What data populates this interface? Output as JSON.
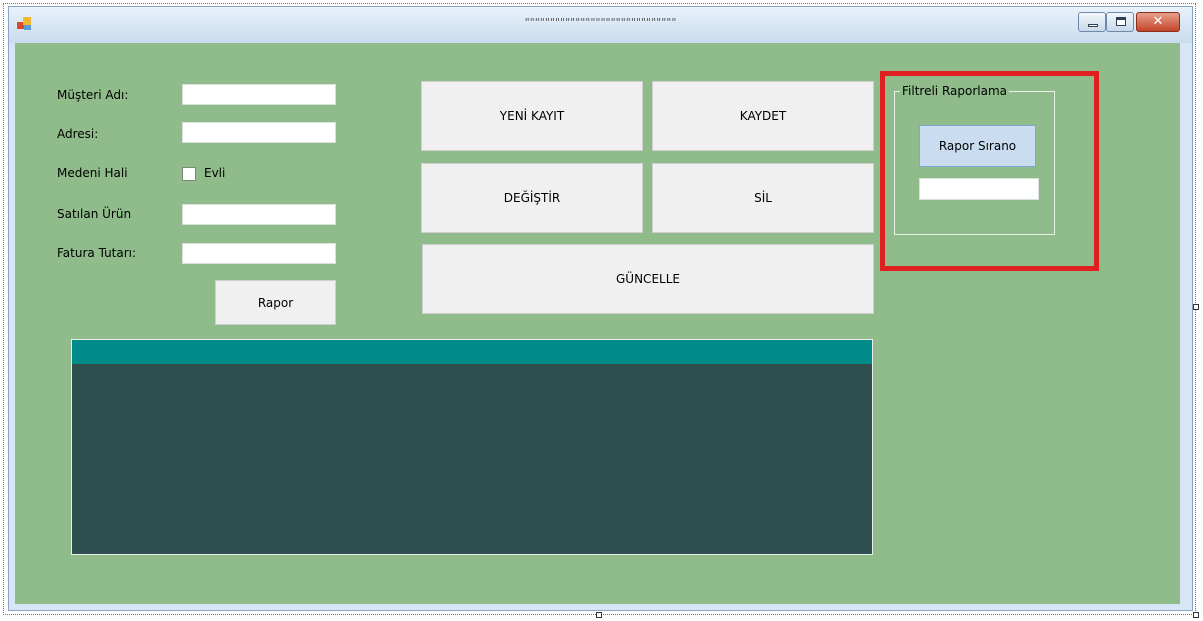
{
  "window": {
    "title": "\"\"\"\"\"\"\"\"\"\"\"\"\"\"\"\"\"\"\"\"\"\"\"\"\"\"\"\"\"\""
  },
  "window_controls": {
    "minimize_icon": "minimize-icon",
    "maximize_icon": "maximize-icon",
    "close_label": "✕"
  },
  "form": {
    "customer_name_label": "Müşteri Adı:",
    "customer_name_value": "",
    "address_label": "Adresi:",
    "address_value": "",
    "marital_status_label": "Medeni Hali",
    "married_label": "Evli",
    "married_checked": false,
    "product_sold_label": "Satılan Ürün",
    "product_sold_value": "",
    "invoice_amount_label": "Fatura Tutarı:",
    "invoice_amount_value": "",
    "report_button": "Rapor"
  },
  "actions": {
    "new_record": "YENİ KAYIT",
    "save": "KAYDET",
    "change": "DEĞİŞTİR",
    "delete": "SİL",
    "update": "GÜNCELLE"
  },
  "filter_group": {
    "title": "Filtreli Raporlama",
    "report_by_no_button": "Rapor Sırano",
    "report_no_value": ""
  },
  "colors": {
    "form_background": "#8fbc8a",
    "grid_background": "#2f4f4f",
    "grid_header": "#008b8b",
    "highlight_border": "#e02020"
  }
}
